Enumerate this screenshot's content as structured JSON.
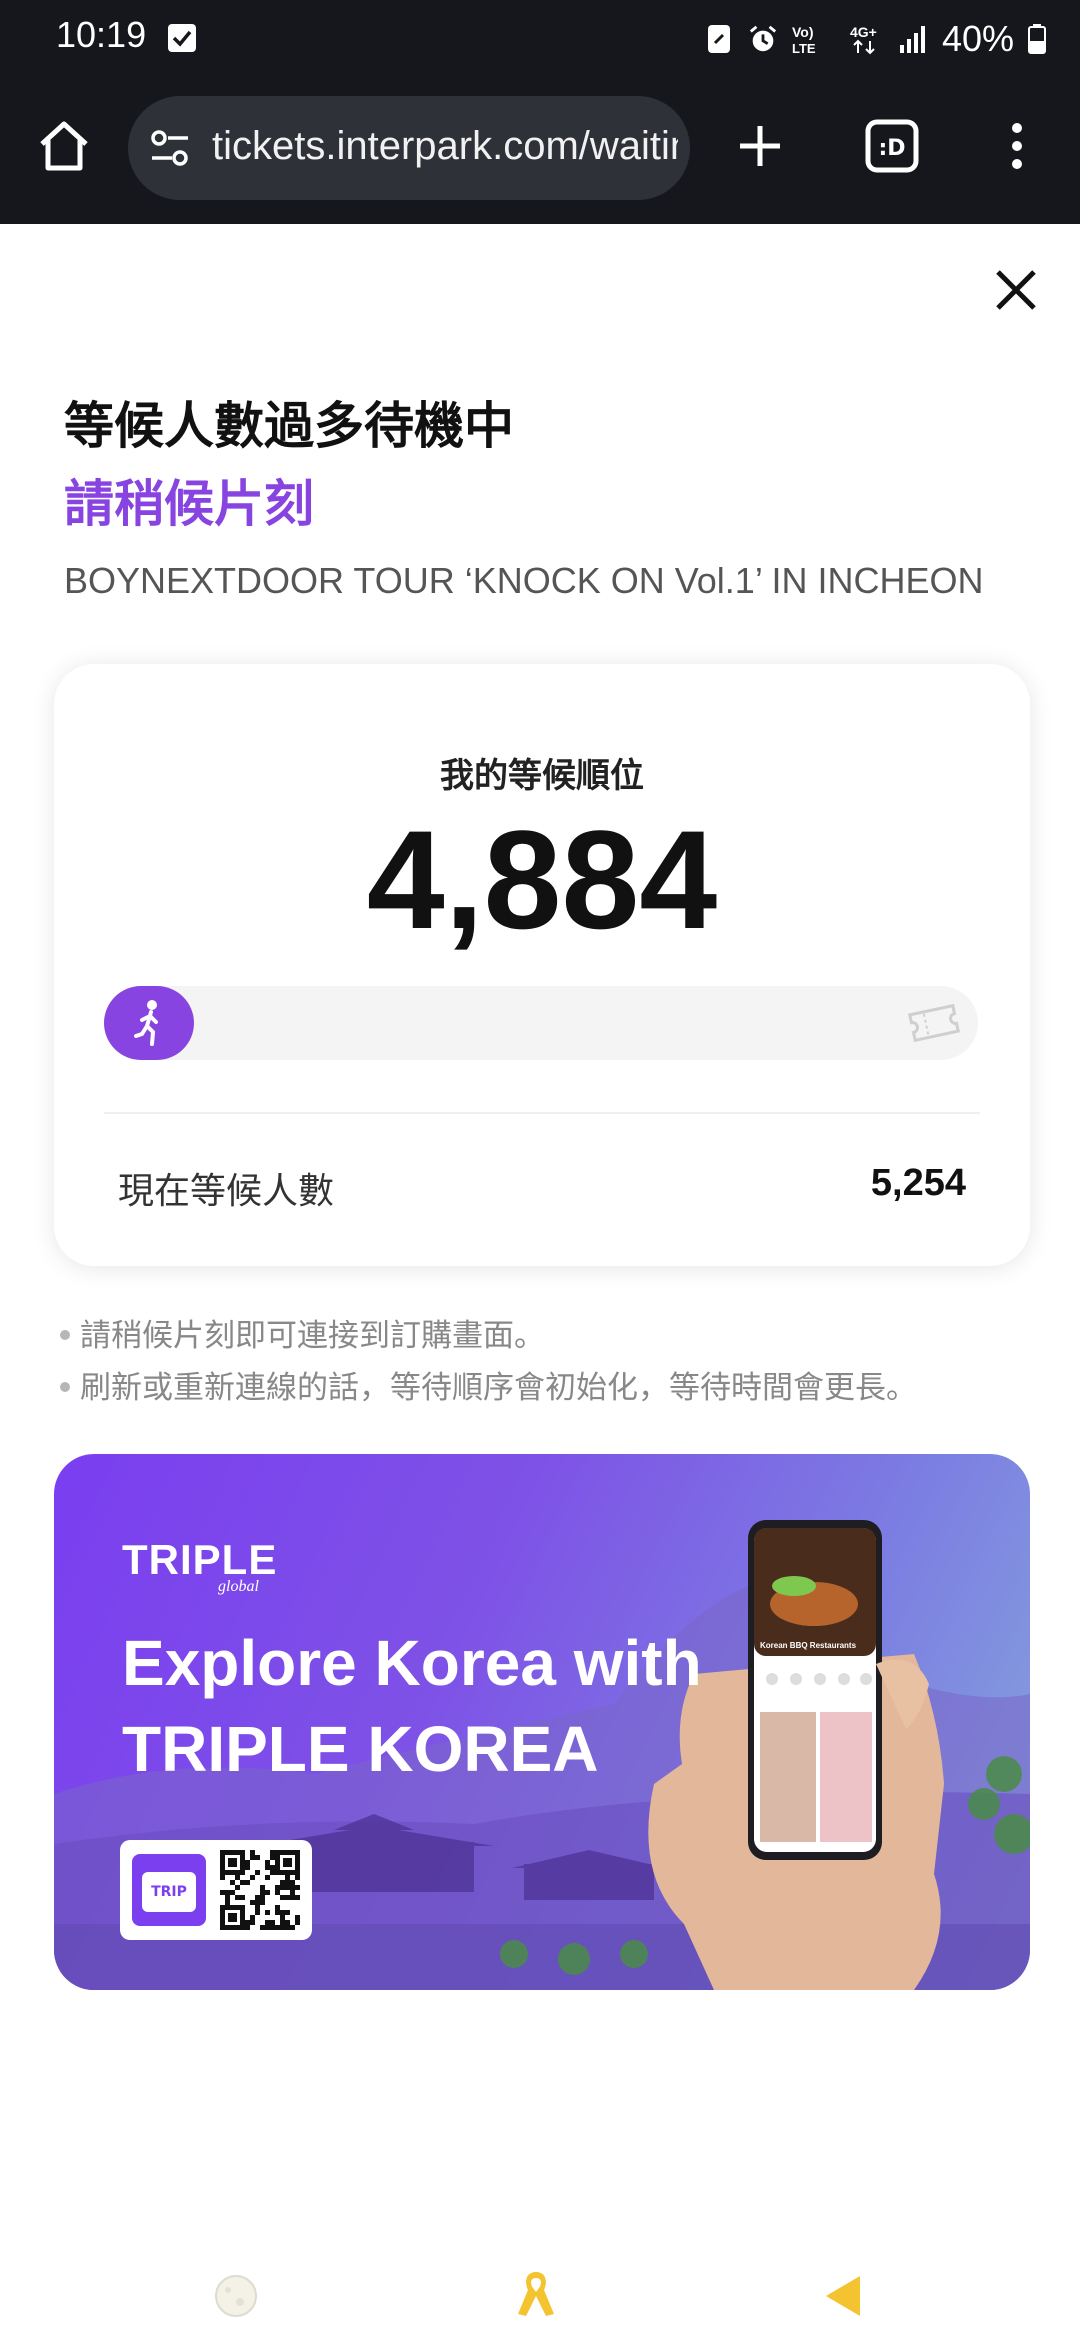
{
  "status_bar": {
    "time": "10:19",
    "network_text": "Vo) LTE  4G+",
    "battery": "40%"
  },
  "browser": {
    "url": "tickets.interpark.com/waiting"
  },
  "header": {
    "title": "等候人數過多待機中",
    "subtitle": "請稍候片刻",
    "event_name": "BOYNEXTDOOR TOUR ‘KNOCK ON Vol.1’ IN INCHEON"
  },
  "queue": {
    "label": "我的等候順位",
    "position": "4,884",
    "progress_fraction": 0.07,
    "waiting_label": "現在等候人數",
    "waiting_count": "5,254"
  },
  "notes": [
    "請稍候片刻即可連接到訂購畫面。",
    "刷新或重新連線的話，等待順序會初始化，等待時間會更長。"
  ],
  "banner": {
    "brand": "TRIPLE",
    "brand_sub": "global",
    "headline_line1": "Explore Korea with",
    "headline_line2": "TRIPLE KOREA",
    "badge": "TRIP",
    "phone_screen_title": "Korean BBQ Restaurants"
  },
  "colors": {
    "accent": "#8844e0",
    "status_bar": "#15171c",
    "url_bar": "#2f3138",
    "nav_ribbon": "#f4c430"
  }
}
